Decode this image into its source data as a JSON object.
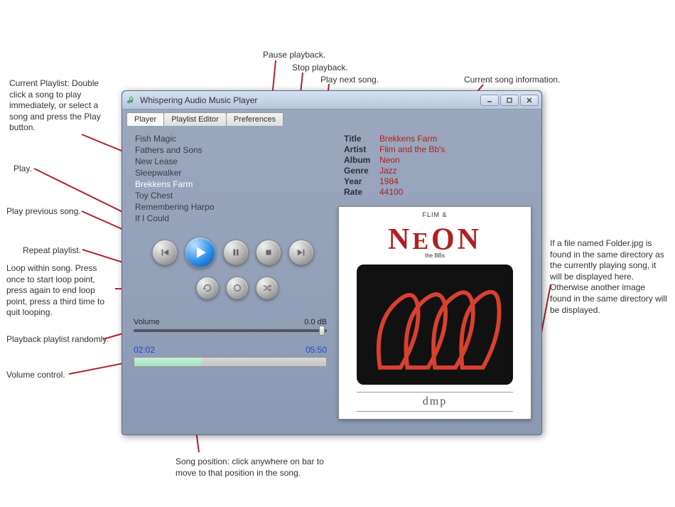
{
  "window": {
    "title": "Whispering Audio Music Player"
  },
  "tabs": [
    {
      "label": "Player",
      "active": true
    },
    {
      "label": "Playlist Editor",
      "active": false
    },
    {
      "label": "Preferences",
      "active": false
    }
  ],
  "playlist": {
    "items": [
      {
        "title": "Fish Magic"
      },
      {
        "title": "Fathers and Sons"
      },
      {
        "title": "New Lease"
      },
      {
        "title": "Sleepwalker"
      },
      {
        "title": "Brekkens Farm",
        "selected": true
      },
      {
        "title": "Toy Chest"
      },
      {
        "title": "Remembering Harpo"
      },
      {
        "title": "If I Could"
      }
    ]
  },
  "volume": {
    "label": "Volume",
    "readout": "0.0 dB",
    "position_pct": 96
  },
  "progress": {
    "elapsed": "02:02",
    "total": "05:50",
    "pct": 35
  },
  "now_playing": {
    "title_label": "Title",
    "title": "Brekkens Farm",
    "artist_label": "Artist",
    "artist": "Flim and the Bb's",
    "album_label": "Album",
    "album": "Neon",
    "genre_label": "Genre",
    "genre": "Jazz",
    "year_label": "Year",
    "year": "1984",
    "rate_label": "Rate",
    "rate": "44100"
  },
  "album_art": {
    "brand_top": "FLIM &",
    "brand_main": "NEON",
    "brand_sub": "the BBs",
    "label_brand": "dmp"
  },
  "annotations": {
    "pause": "Pause playback.",
    "stop": "Stop playback.",
    "next": "Play next song.",
    "current_song_info": "Current song information.",
    "current_playlist": "Current Playlist: Double click a song to play immediately, or select a song and press the Play button.",
    "play": "Play.",
    "prev": "Play previous song.",
    "repeat": "Repeat playlist.",
    "loop": "Loop within song.  Press once to start loop point, press again to end loop point, press a third time to quit looping.",
    "random": "Playback playlist randomly.",
    "volume": "Volume control.",
    "song_position": "Song position: click anywhere on bar to move to that position in the song.",
    "folder_image": "If a file named Folder.jpg is found in the same directory as the currently playing song, it will be displayed here.  Otherwise another image found in the same directory will be displayed."
  }
}
